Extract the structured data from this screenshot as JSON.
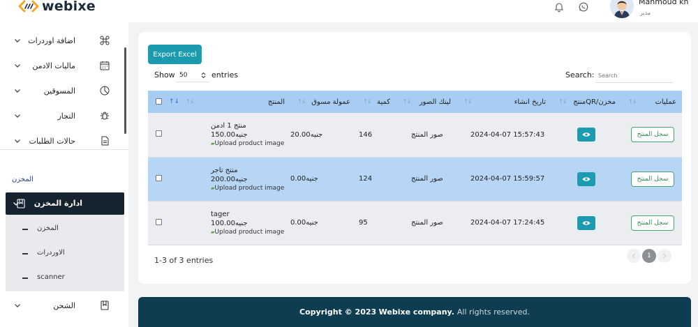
{
  "header": {
    "brand": "webixe",
    "user_name": "Mahmoud kh",
    "user_role": "مدير"
  },
  "sidebar": {
    "items": [
      {
        "label": "اضافة اوردرات",
        "icon": "command-icon"
      },
      {
        "label": "ماليات الادمن",
        "icon": "calendar-icon"
      },
      {
        "label": "المسوقين",
        "icon": "pie-chart-icon"
      },
      {
        "label": "التجار",
        "icon": "bug-icon"
      },
      {
        "label": "حالات الطلبات",
        "icon": "document-icon"
      }
    ],
    "section_title": "المخزن",
    "active_item": {
      "label": "ادارة المخزن",
      "icon": "bookmark-icon"
    },
    "subitems": [
      "المخزن",
      "الاوردرات",
      "scanner"
    ],
    "after_item": {
      "label": "الشحن",
      "icon": "bookmark-icon"
    }
  },
  "toolbar": {
    "export_label": "Export Excel",
    "show_label": "Show",
    "page_size": "50",
    "entries_label": "entries",
    "search_label": "Search:",
    "search_placeholder": "Search"
  },
  "table": {
    "columns": [
      "عمليات",
      "منتجQR/مخزن",
      "تاريخ انشاء",
      "لينك الصور",
      "كمية",
      "عمولة مسوق",
      "المنتج"
    ],
    "rows": [
      {
        "action": "سجل المنتج",
        "created": "2024-04-07 15:57:43",
        "images_link": "صور المنتج",
        "qty": "146",
        "commission": "20.00جنيه",
        "name": "منتج 1 ادمن",
        "price": "150.00جنيه",
        "upload": "Upload product image"
      },
      {
        "action": "سجل المنتج",
        "created": "2024-04-07 15:59:57",
        "images_link": "صور المنتج",
        "qty": "124",
        "commission": "0.00جنيه",
        "name": "منتج تاجر",
        "price": "200.00جنيه",
        "upload": "Upload product image"
      },
      {
        "action": "سجل المنتج",
        "created": "2024-04-07 17:24:45",
        "images_link": "صور المنتج",
        "qty": "95",
        "commission": "0.00جنيه",
        "name": "tager",
        "price": "100.00جنيه",
        "upload": "Upload product image"
      }
    ]
  },
  "pagination": {
    "info": "1-3 of 3 entries",
    "current_page": "1"
  },
  "footer": {
    "copyright": "Copyright © 2023",
    "company": "Webixe company.",
    "rights": "All rights reserved."
  },
  "colors": {
    "accent": "#1c9bb0",
    "header_row": "#a8cdf3",
    "selected_row": "#b7d6f6",
    "sidebar_active": "#15232e",
    "footer_bg": "#0e3d52"
  }
}
